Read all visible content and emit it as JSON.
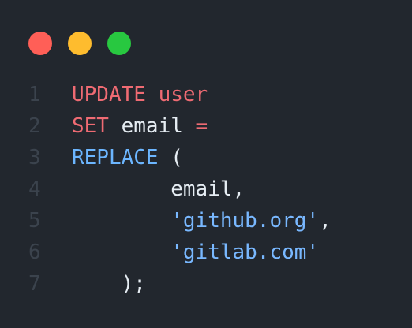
{
  "colors": {
    "background": "#22272e",
    "close": "#ff5f57",
    "minimize": "#febc2e",
    "maximize": "#28c840",
    "line_number": "#3b434d",
    "keyword_red": "#ef6b73",
    "keyword_blue": "#6cb6ff",
    "string": "#79b8ff",
    "text": "#e6edf3"
  },
  "window_controls": [
    "close-icon",
    "minimize-icon",
    "maximize-icon"
  ],
  "code": {
    "lines": [
      {
        "num": "1",
        "tokens": [
          {
            "t": "UPDATE user",
            "c": "kw-red"
          }
        ]
      },
      {
        "num": "2",
        "tokens": [
          {
            "t": "SET",
            "c": "kw-red"
          },
          {
            "t": " email ",
            "c": "plain"
          },
          {
            "t": "=",
            "c": "kw-red"
          }
        ]
      },
      {
        "num": "3",
        "tokens": [
          {
            "t": "REPLACE",
            "c": "kw-blue"
          },
          {
            "t": " (",
            "c": "plain"
          }
        ]
      },
      {
        "num": "4",
        "tokens": [
          {
            "t": "        email,",
            "c": "plain"
          }
        ]
      },
      {
        "num": "5",
        "tokens": [
          {
            "t": "        ",
            "c": "plain"
          },
          {
            "t": "'github.org'",
            "c": "str"
          },
          {
            "t": ",",
            "c": "plain"
          }
        ]
      },
      {
        "num": "6",
        "tokens": [
          {
            "t": "        ",
            "c": "plain"
          },
          {
            "t": "'gitlab.com'",
            "c": "str"
          }
        ]
      },
      {
        "num": "7",
        "tokens": [
          {
            "t": "    );",
            "c": "plain"
          }
        ]
      }
    ]
  }
}
